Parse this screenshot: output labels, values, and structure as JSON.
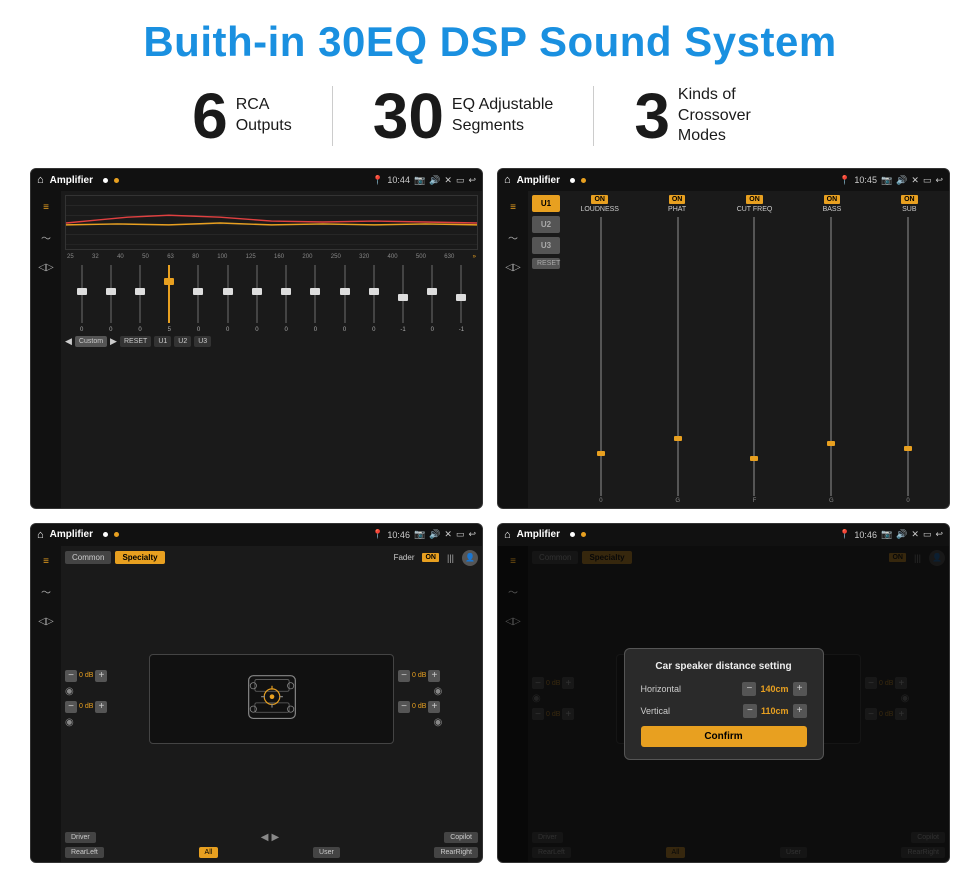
{
  "title": "Buith-in 30EQ DSP Sound System",
  "stats": [
    {
      "number": "6",
      "label": "RCA\nOutputs"
    },
    {
      "number": "30",
      "label": "EQ Adjustable\nSegments"
    },
    {
      "number": "3",
      "label": "Kinds of\nCrossover Modes"
    }
  ],
  "screens": [
    {
      "id": "eq-screen",
      "app_name": "Amplifier",
      "time": "10:44",
      "type": "equalizer",
      "freq_labels": [
        "25",
        "32",
        "40",
        "50",
        "63",
        "80",
        "100",
        "125",
        "160",
        "200",
        "250",
        "320",
        "400",
        "500",
        "630"
      ],
      "slider_values": [
        "0",
        "0",
        "0",
        "5",
        "0",
        "0",
        "0",
        "0",
        "0",
        "0",
        "0",
        "-1",
        "0",
        "-1"
      ],
      "bottom_buttons": [
        "Custom",
        "RESET",
        "U1",
        "U2",
        "U3"
      ]
    },
    {
      "id": "channel-screen",
      "app_name": "Amplifier",
      "time": "10:45",
      "type": "channel",
      "presets": [
        "U1",
        "U2",
        "U3"
      ],
      "channels": [
        "LOUDNESS",
        "PHAT",
        "CUT FREQ",
        "BASS",
        "SUB"
      ],
      "reset_label": "RESET"
    },
    {
      "id": "fader-screen",
      "app_name": "Amplifier",
      "time": "10:46",
      "type": "fader",
      "tabs": [
        "Common",
        "Specialty"
      ],
      "fader_label": "Fader",
      "db_values": [
        "0 dB",
        "0 dB",
        "0 dB",
        "0 dB"
      ],
      "seat_labels": [
        "Driver",
        "Copilot",
        "RearLeft",
        "All",
        "User",
        "RearRight"
      ]
    },
    {
      "id": "distance-screen",
      "app_name": "Amplifier",
      "time": "10:46",
      "type": "distance",
      "tabs": [
        "Common",
        "Specialty"
      ],
      "dialog": {
        "title": "Car speaker distance setting",
        "horizontal_label": "Horizontal",
        "horizontal_value": "140cm",
        "vertical_label": "Vertical",
        "vertical_value": "110cm",
        "confirm_label": "Confirm"
      },
      "db_values": [
        "0 dB",
        "0 dB"
      ],
      "seat_labels": [
        "Driver",
        "Copilot",
        "RearLeft",
        "All",
        "User",
        "RearRight"
      ]
    }
  ]
}
